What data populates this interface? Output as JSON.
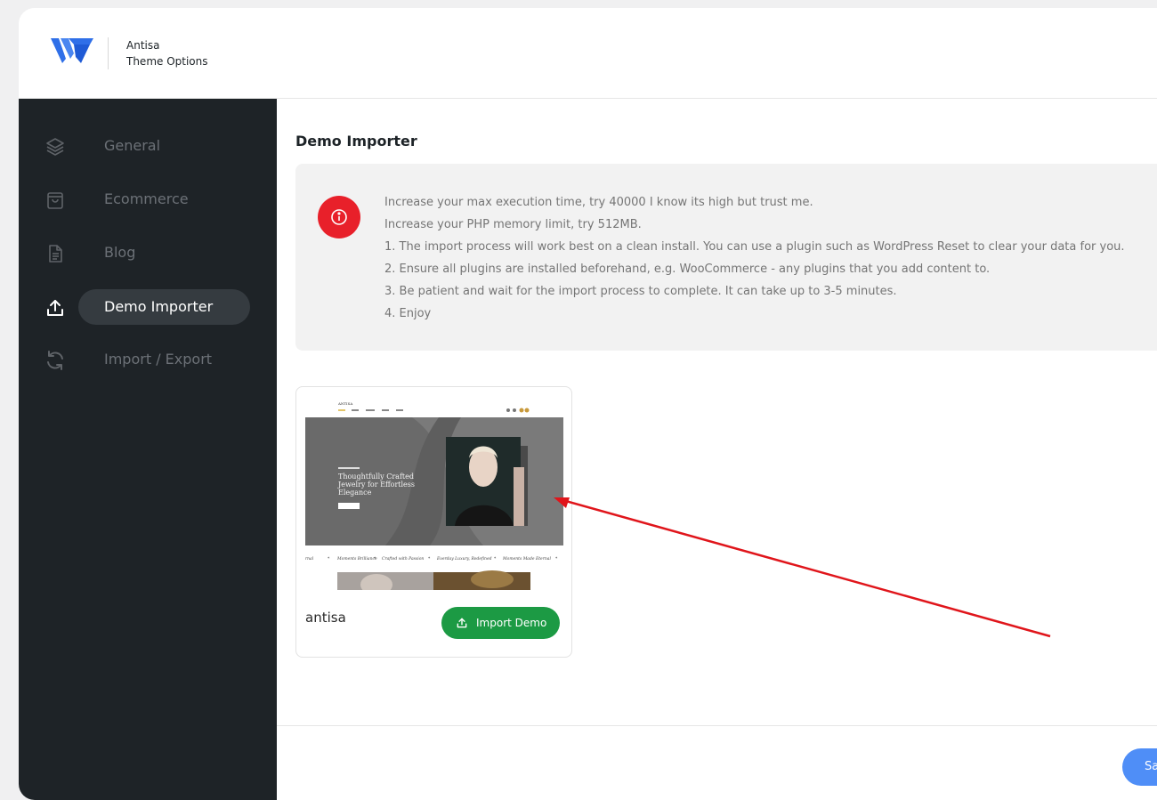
{
  "header": {
    "brand_name": "Antisa",
    "brand_subtitle": "Theme Options"
  },
  "sidebar": {
    "items": [
      {
        "label": "General",
        "icon": "layers-icon",
        "active": false
      },
      {
        "label": "Ecommerce",
        "icon": "shopping-bag-icon",
        "active": false
      },
      {
        "label": "Blog",
        "icon": "document-icon",
        "active": false
      },
      {
        "label": "Demo Importer",
        "icon": "upload-icon",
        "active": true
      },
      {
        "label": "Import / Export",
        "icon": "refresh-icon",
        "active": false
      }
    ]
  },
  "main": {
    "title": "Demo Importer",
    "notice": {
      "icon": "info-icon",
      "lines": [
        "Increase your max execution time, try 40000 I know its high but trust me.",
        "Increase your PHP memory limit, try 512MB.",
        "1. The import process will work best on a clean install. You can use a plugin such as WordPress Reset to clear your data for you.",
        "2. Ensure all plugins are installed beforehand, e.g. WooCommerce - any plugins that you add content to.",
        "3. Be patient and wait for the import process to complete. It can take up to 3-5 minutes.",
        "4. Enjoy"
      ]
    },
    "demo": {
      "name": "antisa",
      "import_label": "Import Demo",
      "preview": {
        "site_logo": "ANTISA",
        "headline_1": "Thoughtfully Crafted",
        "headline_2": "Jewelry for Effortless",
        "headline_3": "Elegance",
        "marquee": [
          "rnal",
          "Moments Brilliance",
          "Crafted with Passion",
          "Everday Luxury, Redefined",
          "Moments Made Eternal"
        ]
      }
    },
    "save_label": "Sa"
  },
  "colors": {
    "sidebar_bg": "#1e2327",
    "active_pill": "#353b40",
    "notice_icon": "#e8202a",
    "import_button": "#1c9a44",
    "save_button": "#4f8ef7",
    "annotation_arrow": "#e0151b"
  }
}
